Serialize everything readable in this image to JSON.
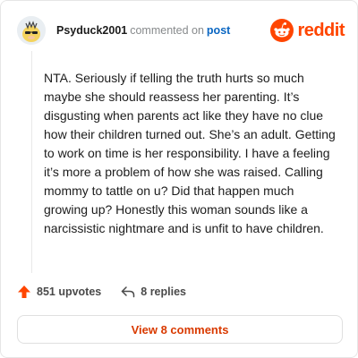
{
  "comment": {
    "username": "Psyduck2001",
    "action_text": "commented on",
    "target_link": "post",
    "body": "NTA. Seriously if telling the truth hurts so much maybe she should reassess her parenting. It’s disgusting when parents act like they have no clue how their children turned out. She’s an adult. Getting to work on time is her responsibility. I have a feeling it’s more a problem of how she was raised. Calling mommy to tattle on u? Did that happen much growing up? Honestly this woman sounds like a narcissistic nightmare and is unfit to have children."
  },
  "brand": {
    "wordmark": "reddit",
    "icon": "reddit-alien-icon",
    "color": "#ff4500"
  },
  "actions": {
    "upvotes": "851 upvotes",
    "replies": "8 replies"
  },
  "footer": {
    "view_label": "View 8 comments"
  },
  "colors": {
    "accent": "#ff4500",
    "link": "#0a66c2",
    "button_text": "#d93a00"
  }
}
